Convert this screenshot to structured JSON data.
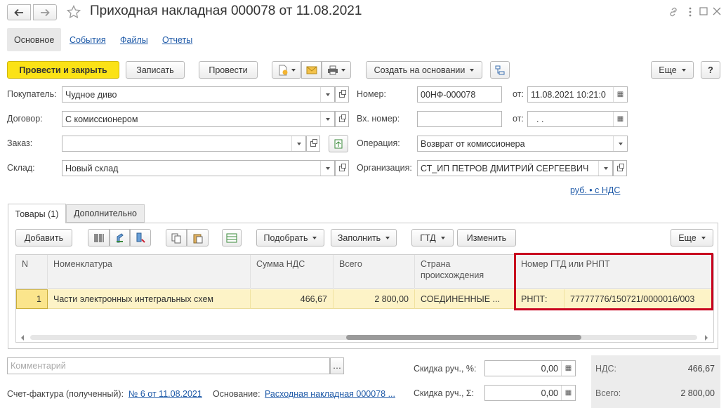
{
  "window": {
    "title": "Приходная накладная 000078 от 11.08.2021",
    "back_icon": "arrow-left-icon",
    "forward_icon": "arrow-right-icon",
    "star_icon": "star-icon",
    "link_icon": "link-icon",
    "menu_icon": "more-vertical-icon",
    "maximize_icon": "maximize-icon",
    "close_icon": "close-icon"
  },
  "nav_tabs": [
    "Основное",
    "События",
    "Файлы",
    "Отчеты"
  ],
  "toolbar": {
    "post_close": "Провести и закрыть",
    "save": "Записать",
    "post": "Провести",
    "create_based": "Создать на основании",
    "more": "Еще",
    "help": "?"
  },
  "form": {
    "buyer_label": "Покупатель:",
    "buyer_value": "Чудное диво",
    "contract_label": "Договор:",
    "contract_value": "С комиссионером",
    "order_label": "Заказ:",
    "order_value": "",
    "warehouse_label": "Склад:",
    "warehouse_value": "Новый склад",
    "number_label": "Номер:",
    "number_value": "00НФ-000078",
    "from_label": "от:",
    "date_value": "11.08.2021 10:21:0",
    "in_number_label": "Вх. номер:",
    "in_number_value": "",
    "from2_label": "от:",
    "in_date_value": " .  .",
    "operation_label": "Операция:",
    "operation_value": "Возврат от комиссионера",
    "org_label": "Организация:",
    "org_value": "СТ_ИП ПЕТРОВ ДМИТРИЙ СЕРГЕЕВИЧ",
    "currency_link": "руб. • с НДС"
  },
  "inner_tabs": [
    "Товары (1)",
    "Дополнительно"
  ],
  "grid_toolbar": {
    "add": "Добавить",
    "select": "Подобрать",
    "fill": "Заполнить",
    "gtd": "ГТД",
    "change": "Изменить",
    "more": "Еще"
  },
  "table": {
    "columns": [
      "N",
      "Номенклатура",
      "Сумма НДС",
      "Всего",
      "Страна происхождения",
      "Номер ГТД или РНПТ"
    ],
    "rows": [
      {
        "n": "1",
        "name": "Части электронных интегральных схем",
        "vat": "466,67",
        "total": "2 800,00",
        "country": "СОЕДИНЕННЫЕ ...",
        "gtd_type": "РНПТ:",
        "gtd_number": "77777776/150721/0000016/003"
      }
    ]
  },
  "footer": {
    "comment_placeholder": "Комментарий",
    "discount_pct_label": "Скидка руч., %:",
    "discount_pct_value": "0,00",
    "discount_sum_label": "Скидка руч., Σ:",
    "discount_sum_value": "0,00",
    "vat_label": "НДС:",
    "vat_value": "466,67",
    "total_label": "Всего:",
    "total_value": "2 800,00",
    "invoice_label": "Счет-фактура (полученный):",
    "invoice_link": "№ 6 от 11.08.2021",
    "basis_label": "Основание:",
    "basis_link": "Расходная накладная 000078 ..."
  },
  "colors": {
    "primary_button": "#fbe216",
    "highlight_border": "#c8001e",
    "selected_row": "#fdf3c7",
    "link": "#1f5aa8"
  }
}
